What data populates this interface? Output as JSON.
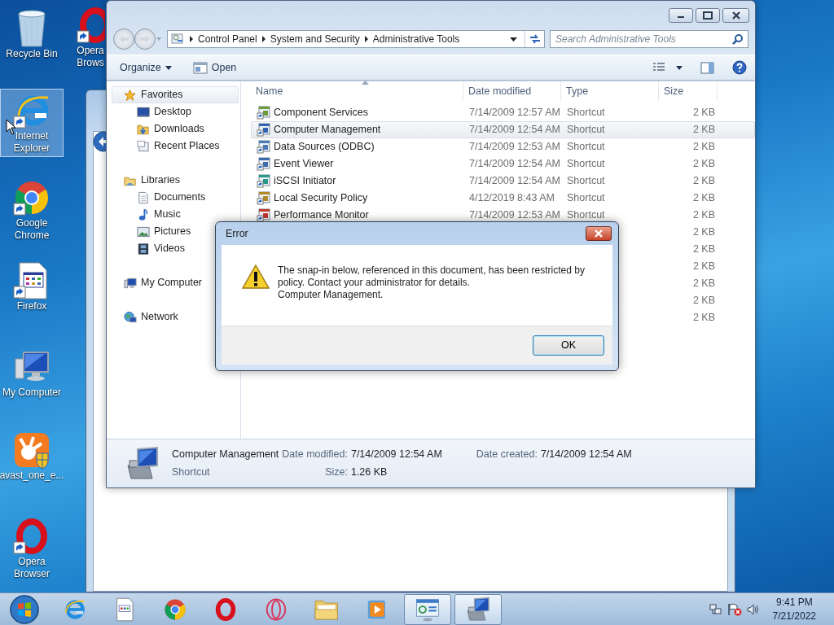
{
  "desktop_icons": [
    {
      "label": "Recycle Bin",
      "selected": false
    },
    {
      "label": "Opera Brows",
      "selected": false
    },
    {
      "label": "Internet Explorer",
      "selected": true
    },
    {
      "label": "Google Chrome",
      "selected": false
    },
    {
      "label": "Firefox",
      "selected": false
    },
    {
      "label": "My Computer",
      "selected": false
    },
    {
      "label": "avast_one_e...",
      "selected": false
    },
    {
      "label": "Opera Browser",
      "selected": false
    }
  ],
  "explorer": {
    "back": {
      "disabled": true
    },
    "forward": {
      "disabled": true
    },
    "breadcrumb": [
      "Control Panel",
      "System and Security",
      "Administrative Tools"
    ],
    "search": {
      "placeholder": "Search Administrative Tools"
    },
    "toolbar": [
      "Organize",
      "Open"
    ],
    "nav": [
      {
        "label": "Favorites",
        "selected": true,
        "children": [
          {
            "label": "Desktop",
            "selected": false
          },
          {
            "label": "Downloads",
            "selected": false
          },
          {
            "label": "Recent Places",
            "selected": false
          }
        ]
      },
      {
        "label": "Libraries",
        "selected": false,
        "children": [
          {
            "label": "Documents",
            "selected": false
          },
          {
            "label": "Music",
            "selected": false
          },
          {
            "label": "Pictures",
            "selected": false
          },
          {
            "label": "Videos",
            "selected": false
          }
        ]
      },
      {
        "label": "My Computer",
        "selected": false
      },
      {
        "label": "Network",
        "selected": false
      }
    ],
    "columns": [
      "Name",
      "Date modified",
      "Type",
      "Size"
    ],
    "files": [
      {
        "name": "Component Services",
        "date": "7/14/2009 12:57 AM",
        "type": "Shortcut",
        "size": "2 KB",
        "selected": false
      },
      {
        "name": "Computer Management",
        "date": "7/14/2009 12:54 AM",
        "type": "Shortcut",
        "size": "2 KB",
        "selected": true
      },
      {
        "name": "Data Sources (ODBC)",
        "date": "7/14/2009 12:53 AM",
        "type": "Shortcut",
        "size": "2 KB",
        "selected": false
      },
      {
        "name": "Event Viewer",
        "date": "7/14/2009 12:54 AM",
        "type": "Shortcut",
        "size": "2 KB",
        "selected": false
      },
      {
        "name": "iSCSI Initiator",
        "date": "7/14/2009 12:54 AM",
        "type": "Shortcut",
        "size": "2 KB",
        "selected": false
      },
      {
        "name": "Local Security Policy",
        "date": "4/12/2019 8:43 AM",
        "type": "Shortcut",
        "size": "2 KB",
        "selected": false
      },
      {
        "name": "Performance Monitor",
        "date": "7/14/2009 12:53 AM",
        "type": "Shortcut",
        "size": "2 KB",
        "selected": false
      },
      {
        "size": "2 KB",
        "selected": false
      },
      {
        "size": "2 KB",
        "selected": false
      },
      {
        "size": "2 KB",
        "selected": false
      },
      {
        "size": "2 KB",
        "selected": false
      },
      {
        "size": "2 KB",
        "selected": false
      },
      {
        "size": "2 KB",
        "selected": false
      }
    ],
    "details": {
      "name": "Computer Management",
      "type": "Shortcut",
      "date_modified_label": "Date modified:",
      "date_modified": "7/14/2009 12:54 AM",
      "date_created_label": "Date created:",
      "date_created": "7/14/2009 12:54 AM",
      "size_label": "Size:",
      "size": "1.26 KB"
    }
  },
  "dialog": {
    "title": "Error",
    "message": [
      "The snap-in below, referenced in this document, has been restricted by policy. Contact your administrator for details.",
      "Computer Management."
    ],
    "button": "OK"
  },
  "taskbar": {
    "items": [
      {
        "running": false
      },
      {
        "running": false
      },
      {
        "running": false
      },
      {
        "running": false
      },
      {
        "running": false
      },
      {
        "running": false
      },
      {
        "running": false
      },
      {
        "running": true
      },
      {
        "running": true
      }
    ],
    "clock": {
      "time": "9:41 PM",
      "date": "7/21/2022"
    }
  }
}
